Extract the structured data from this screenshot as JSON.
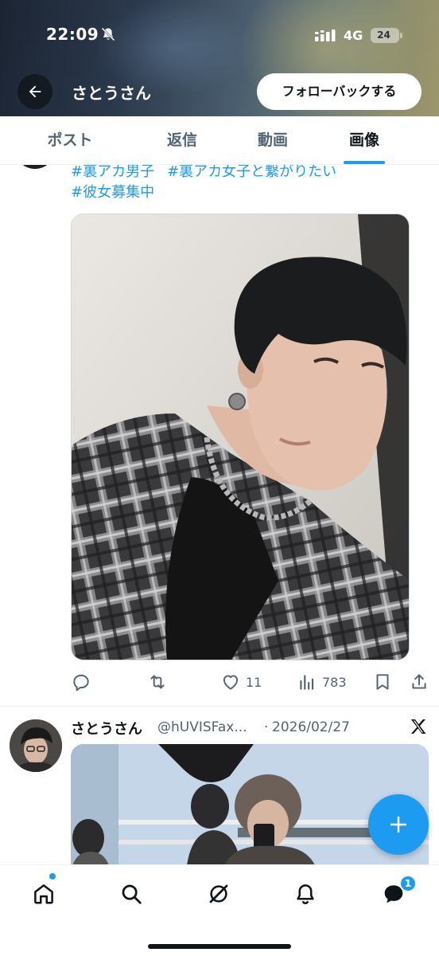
{
  "status_bar": {
    "time": "22:09",
    "network": "4G",
    "battery": "24"
  },
  "header": {
    "name": "さとうさん",
    "follow_back_label": "フォローバックする",
    "back_icon": "arrow-left-icon"
  },
  "tabs": [
    {
      "label": "ポスト",
      "active": false
    },
    {
      "label": "返信",
      "active": false
    },
    {
      "label": "動画",
      "active": false
    },
    {
      "label": "画像",
      "active": true
    }
  ],
  "post1": {
    "hashtags": [
      "#裏アカ男子",
      "#裏アカ女子と繋がりたい",
      "#彼女募集中"
    ],
    "actions": {
      "reply_count": "",
      "repost_count": "",
      "like_count": "11",
      "view_count": "783"
    }
  },
  "post2": {
    "name": "さとうさん",
    "handle": "@hUVISFax...",
    "separator": "·",
    "date": "2026/02/27"
  },
  "bottom_nav": {
    "items": [
      "home-icon",
      "search-icon",
      "grok-icon",
      "notifications-icon",
      "messages-icon"
    ],
    "messages_badge": "1"
  },
  "colors": {
    "accent": "#1d9bf0",
    "text": "#0f1419",
    "muted": "#536471"
  }
}
